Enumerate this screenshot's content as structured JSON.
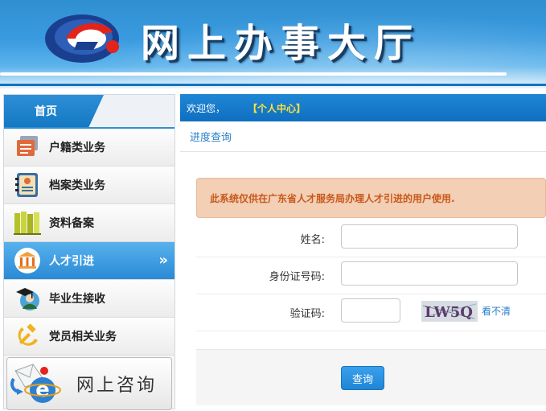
{
  "header": {
    "title": "网上办事大厅",
    "logo_icon": "swirl-logo-icon"
  },
  "sidebar": {
    "home_tab": "首页",
    "items": [
      {
        "label": "户籍类业务",
        "icon": "household-register-icon",
        "active": false
      },
      {
        "label": "档案类业务",
        "icon": "archive-folder-icon",
        "active": false
      },
      {
        "label": "资料备案",
        "icon": "books-icon",
        "active": false
      },
      {
        "label": "人才引进",
        "icon": "bank-building-icon",
        "active": true
      },
      {
        "label": "毕业生接收",
        "icon": "graduate-cap-icon",
        "active": false
      },
      {
        "label": "党员相关业务",
        "icon": "hammer-sickle-icon",
        "active": false
      }
    ],
    "consult_label": "网上咨询",
    "active_chevron": "»"
  },
  "topbar": {
    "welcome": "欢迎您，",
    "user_center": "【个人中心】"
  },
  "subtabs": {
    "progress_query": "进度查询"
  },
  "notice": "此系统仅供在广东省人才服务局办理人才引进的用户使用.",
  "form": {
    "name_label": "姓名:",
    "name_value": "",
    "id_label": "身份证号码:",
    "id_value": "",
    "captcha_label": "验证码:",
    "captcha_value": "",
    "captcha_text": "LW5Q",
    "refresh_label": "看不清",
    "submit_label": "查询"
  },
  "colors": {
    "primary_blue": "#1f86d6",
    "notice_bg": "#f2cfb5",
    "notice_text": "#c9581a",
    "user_center": "#ffe03a"
  }
}
